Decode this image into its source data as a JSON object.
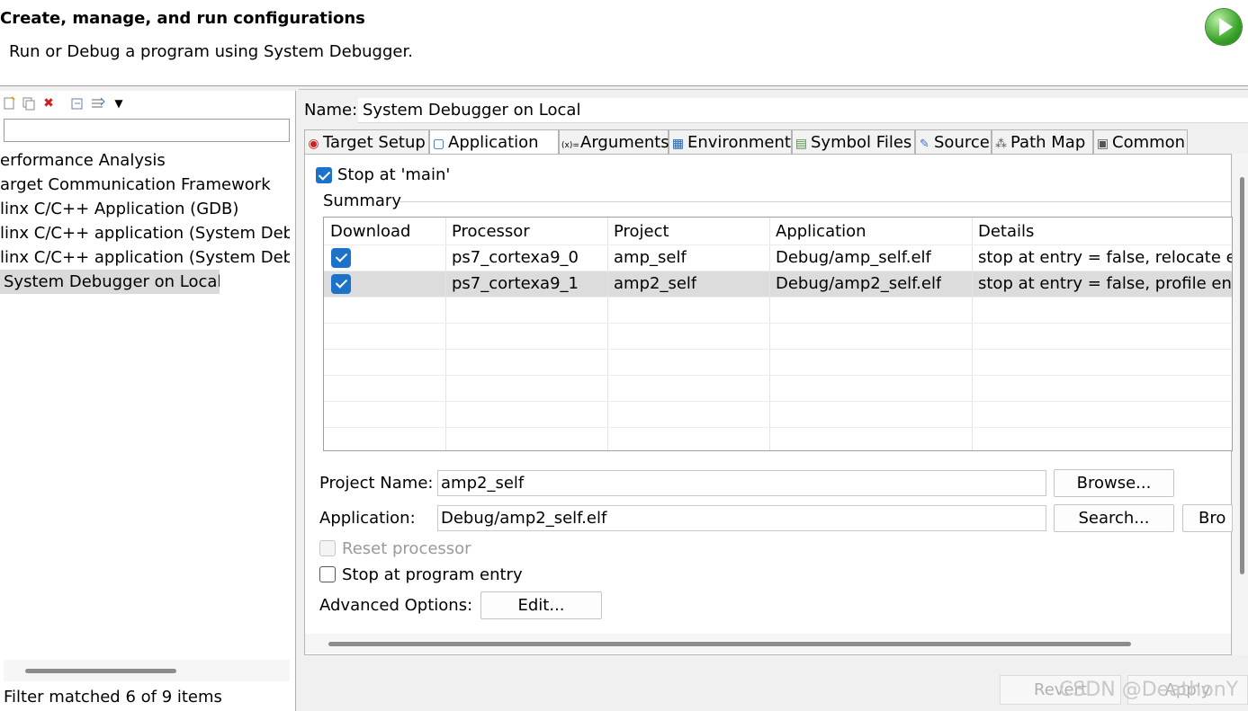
{
  "header": {
    "title": "Create, manage, and run configurations",
    "subtitle": "Run or Debug a program using System Debugger.",
    "run_icon": "run-icon"
  },
  "sidebar": {
    "toolbar_icons": [
      "new-configuration-icon",
      "duplicate-icon",
      "delete-icon",
      "collapse-all-icon",
      "filter-icon",
      "view-menu-icon"
    ],
    "delete_icon_glyph": "✖",
    "menu_glyph": "▼",
    "filter_value": "",
    "items": [
      {
        "label": "erformance Analysis"
      },
      {
        "label": "arget Communication Framework"
      },
      {
        "label": "linx C/C++ Application (GDB)"
      },
      {
        "label": "linx C/C++ application (System Debu"
      },
      {
        "label": "linx C/C++ application (System Debu"
      },
      {
        "label": "System Debugger on Local"
      }
    ],
    "status": "Filter matched 6 of 9 items"
  },
  "config": {
    "name_label": "Name:",
    "name_value": "System Debugger on Local"
  },
  "tabs": [
    {
      "label": "Target Setup",
      "icon": "target-icon",
      "glyph": "◉"
    },
    {
      "label": "Application",
      "icon": "application-icon",
      "glyph": "▢"
    },
    {
      "label": "Arguments",
      "icon": "arguments-icon",
      "glyph": "(x)="
    },
    {
      "label": "Environment",
      "icon": "environment-icon",
      "glyph": "▦"
    },
    {
      "label": "Symbol Files",
      "icon": "symbol-files-icon",
      "glyph": "▤"
    },
    {
      "label": "Source",
      "icon": "source-icon",
      "glyph": "✎"
    },
    {
      "label": "Path Map",
      "icon": "path-map-icon",
      "glyph": "⁂"
    },
    {
      "label": "Common",
      "icon": "common-icon",
      "glyph": "▣"
    }
  ],
  "application": {
    "stop_at_main": "Stop at 'main'",
    "summary_label": "Summary",
    "table": {
      "headers": [
        "Download",
        "Processor",
        "Project",
        "Application",
        "Details"
      ],
      "rows": [
        {
          "processor": "ps7_cortexa9_0",
          "project": "amp_self",
          "application": "Debug/amp_self.elf",
          "details": "stop at entry = false, relocate elf"
        },
        {
          "processor": "ps7_cortexa9_1",
          "project": "amp2_self",
          "application": "Debug/amp2_self.elf",
          "details": "stop at entry = false, profile enab"
        }
      ]
    },
    "project_name_label": "Project Name:",
    "project_name_value": "amp2_self",
    "browse_label": "Browse...",
    "application_label": "Application:",
    "application_value": "Debug/amp2_self.elf",
    "search_label": "Search...",
    "browse2_label": "Bro",
    "reset_processor": "Reset processor",
    "stop_at_entry": "Stop at program entry",
    "advanced_label": "Advanced Options:",
    "edit_label": "Edit..."
  },
  "footer": {
    "revert_label": "Revert",
    "apply_label": "Apply",
    "watermark": "CSDN @DeathonY"
  }
}
